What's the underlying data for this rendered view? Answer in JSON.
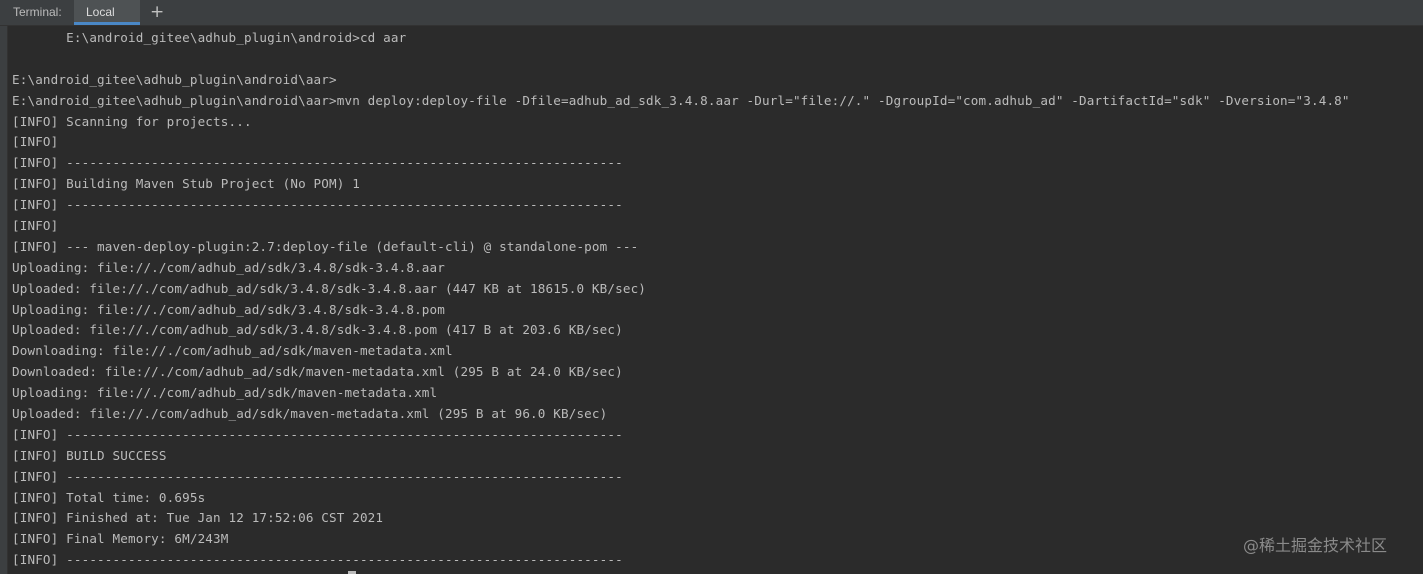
{
  "tabs": {
    "label": "Terminal:",
    "active_tab": "Local",
    "add_symbol": "+"
  },
  "terminal": {
    "lines": [
      "       E:\\android_gitee\\adhub_plugin\\android>cd aar",
      "",
      "E:\\android_gitee\\adhub_plugin\\android\\aar>",
      "E:\\android_gitee\\adhub_plugin\\android\\aar>mvn deploy:deploy-file -Dfile=adhub_ad_sdk_3.4.8.aar -Durl=\"file://.\" -DgroupId=\"com.adhub_ad\" -DartifactId=\"sdk\" -Dversion=\"3.4.8\"",
      "[INFO] Scanning for projects...",
      "[INFO]",
      "[INFO] ------------------------------------------------------------------------",
      "[INFO] Building Maven Stub Project (No POM) 1",
      "[INFO] ------------------------------------------------------------------------",
      "[INFO]",
      "[INFO] --- maven-deploy-plugin:2.7:deploy-file (default-cli) @ standalone-pom ---",
      "Uploading: file://./com/adhub_ad/sdk/3.4.8/sdk-3.4.8.aar",
      "Uploaded: file://./com/adhub_ad/sdk/3.4.8/sdk-3.4.8.aar (447 KB at 18615.0 KB/sec)",
      "Uploading: file://./com/adhub_ad/sdk/3.4.8/sdk-3.4.8.pom",
      "Uploaded: file://./com/adhub_ad/sdk/3.4.8/sdk-3.4.8.pom (417 B at 203.6 KB/sec)",
      "Downloading: file://./com/adhub_ad/sdk/maven-metadata.xml",
      "Downloaded: file://./com/adhub_ad/sdk/maven-metadata.xml (295 B at 24.0 KB/sec)",
      "Uploading: file://./com/adhub_ad/sdk/maven-metadata.xml",
      "Uploaded: file://./com/adhub_ad/sdk/maven-metadata.xml (295 B at 96.0 KB/sec)",
      "[INFO] ------------------------------------------------------------------------",
      "[INFO] BUILD SUCCESS",
      "[INFO] ------------------------------------------------------------------------",
      "[INFO] Total time: 0.695s",
      "[INFO] Finished at: Tue Jan 12 17:52:06 CST 2021",
      "[INFO] Final Memory: 6M/243M",
      "[INFO] ------------------------------------------------------------------------"
    ]
  },
  "watermark": "@稀土掘金技术社区",
  "colors": {
    "background": "#2b2b2b",
    "text": "#bbbbbb",
    "tab_underline": "#4a88c7"
  }
}
